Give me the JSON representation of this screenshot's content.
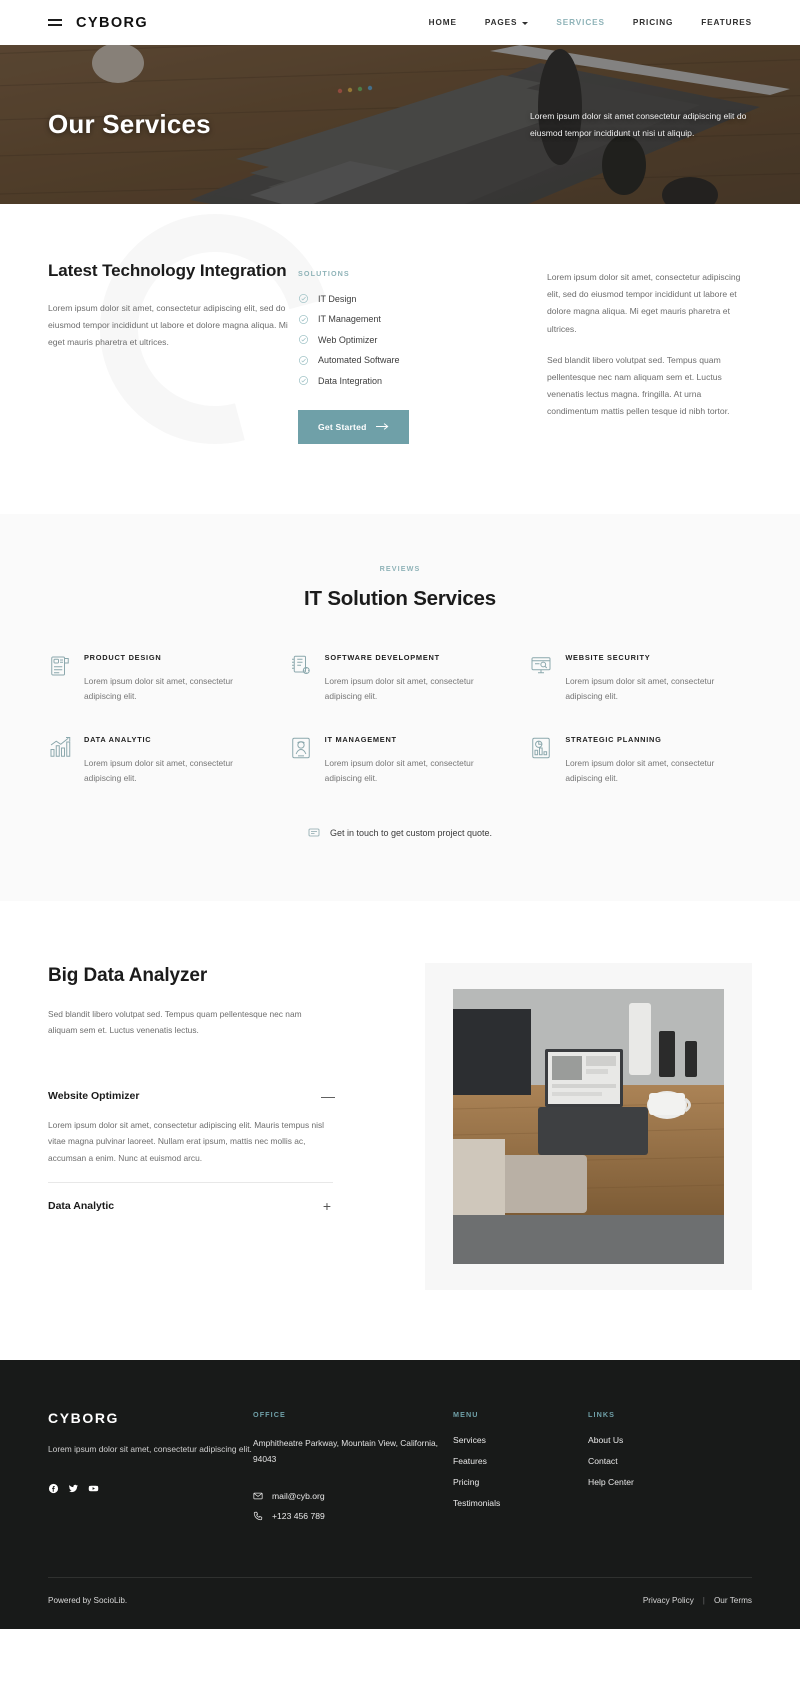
{
  "nav": {
    "brand": "CYBORG",
    "menu_icon": "hamburger-icon",
    "links": [
      {
        "label": "HOME",
        "active": false,
        "caret": false
      },
      {
        "label": "PAGES",
        "active": false,
        "caret": true
      },
      {
        "label": "SERVICES",
        "active": true,
        "caret": false
      },
      {
        "label": "PRICING",
        "active": false,
        "caret": false
      },
      {
        "label": "FEATURES",
        "active": false,
        "caret": false
      }
    ]
  },
  "hero": {
    "title": "Our Services",
    "subtitle": "Lorem ipsum dolor sit amet consectetur adipiscing elit do eiusmod tempor incididunt ut  nisi ut aliquip."
  },
  "tech": {
    "heading": "Latest Technology Integration",
    "body": "Lorem ipsum dolor sit amet, consectetur adipiscing elit, sed do eiusmod tempor incididunt ut labore et dolore magna aliqua. Mi eget mauris pharetra et ultrices.",
    "solutions_label": "SOLUTIONS",
    "solutions": [
      "IT Design",
      "IT Management",
      "Web Optimizer",
      "Automated Software",
      "Data Integration"
    ],
    "cta_label": "Get Started",
    "cta_icon": "arrow-right-icon",
    "paragraph_1": "Lorem ipsum dolor sit amet, consectetur adipiscing elit, sed do eiusmod tempor incididunt ut labore et dolore magna aliqua. Mi eget mauris pharetra et ultrices.",
    "paragraph_2": "Sed blandit libero volutpat sed. Tempus quam pellentesque nec nam aliquam sem et. Luctus venenatis lectus magna. fringilla. At urna condimentum mattis pellen tesque id nibh tortor.",
    "accent_color": "#6fa0a8"
  },
  "solutions": {
    "eyebrow": "REVIEWS",
    "heading": "IT Solution Services",
    "cards": [
      {
        "icon": "product-design-icon",
        "title": "PRODUCT DESIGN",
        "text": "Lorem ipsum dolor sit amet, consectetur adipiscing elit."
      },
      {
        "icon": "software-development-icon",
        "title": "SOFTWARE DEVELOPMENT",
        "text": "Lorem ipsum dolor sit amet, consectetur adipiscing elit."
      },
      {
        "icon": "website-security-icon",
        "title": "WEBSITE SECURITY",
        "text": "Lorem ipsum dolor sit amet, consectetur adipiscing elit."
      },
      {
        "icon": "data-analytic-icon",
        "title": "DATA ANALYTIC",
        "text": "Lorem ipsum dolor sit amet, consectetur adipiscing elit."
      },
      {
        "icon": "it-management-icon",
        "title": "IT MANAGEMENT",
        "text": "Lorem ipsum dolor sit amet, consectetur adipiscing elit."
      },
      {
        "icon": "strategic-planning-icon",
        "title": "STRATEGIC PLANNING",
        "text": "Lorem ipsum dolor sit amet, consectetur adipiscing elit."
      }
    ],
    "contact_note": "Get in touch to get custom project quote.",
    "contact_icon": "chat-bubble-icon"
  },
  "bigdata": {
    "heading": "Big Data Analyzer",
    "description": "Sed blandit libero volutpat sed. Tempus quam pellentesque nec nam aliquam sem et. Luctus venenatis lectus.",
    "accordion": [
      {
        "title": "Website Optimizer",
        "sign": "—",
        "open": true,
        "body": "Lorem ipsum dolor sit amet, consectetur adipiscing elit. Mauris tempus nisl vitae magna pulvinar laoreet. Nullam erat ipsum, mattis nec mollis ac, accumsan a enim. Nunc at euismod arcu."
      },
      {
        "title": "Data Analytic",
        "sign": "+",
        "open": false,
        "body": ""
      }
    ],
    "image_alt": "tablet-on-wooden-desk-photo"
  },
  "footer": {
    "brand": "CYBORG",
    "tagline": "Lorem ipsum dolor sit amet, consectetur adipiscing elit.",
    "social": [
      "facebook-icon",
      "twitter-icon",
      "youtube-icon"
    ],
    "office_label": "OFFICE",
    "address": "Amphitheatre Parkway, Mountain View, California, 94043",
    "email": "mail@cyb.org",
    "email_icon": "mail-icon",
    "phone": "+123 456 789",
    "phone_icon": "phone-icon",
    "menu_label": "MENU",
    "menu_items": [
      "Services",
      "Features",
      "Pricing",
      "Testimonials"
    ],
    "links_label": "LINKS",
    "links_items": [
      "About Us",
      "Contact",
      "Help Center"
    ],
    "copyright": "Powered by SocioLib.",
    "legal": [
      "Privacy Policy",
      "Our Terms"
    ],
    "separator": "|",
    "accent_color": "#6fa0a8"
  }
}
